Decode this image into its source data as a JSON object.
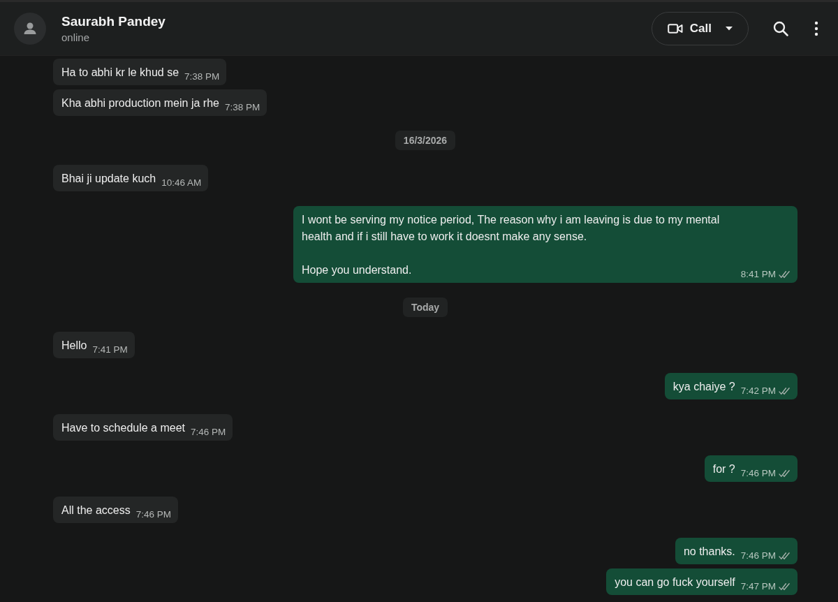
{
  "header": {
    "name": "Saurabh Pandey",
    "status": "online",
    "call_button": "Call"
  },
  "messages": [
    {
      "kind": "in",
      "text": "Ha to abhi kr le khud se",
      "time": "7:38 PM"
    },
    {
      "kind": "in",
      "text": "Kha abhi production mein ja rhe",
      "time": "7:38 PM"
    },
    {
      "kind": "date",
      "text": "16/3/2026"
    },
    {
      "kind": "in",
      "text": "Bhai ji update kuch",
      "time": "10:46 AM"
    },
    {
      "kind": "out",
      "text": "I wont be serving my notice period, The reason why i am leaving is due to my mental health and if i still have to work it doesnt make any sense.\n\nHope you understand.",
      "time": "8:41 PM"
    },
    {
      "kind": "date",
      "text": "Today"
    },
    {
      "kind": "in",
      "text": "Hello",
      "time": "7:41 PM"
    },
    {
      "kind": "out",
      "text": "kya chaiye ?",
      "time": "7:42 PM"
    },
    {
      "kind": "in",
      "text": "Have to schedule a meet",
      "time": "7:46 PM"
    },
    {
      "kind": "out",
      "text": "for ?",
      "time": "7:46 PM"
    },
    {
      "kind": "in",
      "text": "All the access",
      "time": "7:46 PM"
    },
    {
      "kind": "out",
      "text": "no thanks.",
      "time": "7:46 PM"
    },
    {
      "kind": "out",
      "text": "you can go fuck yourself",
      "time": "7:47 PM"
    }
  ]
}
